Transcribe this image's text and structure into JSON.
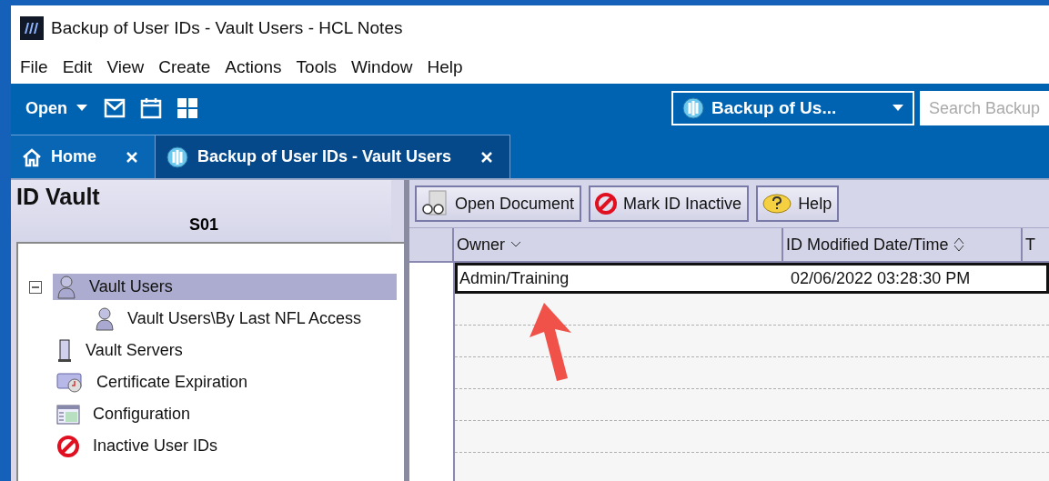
{
  "window": {
    "title": "Backup of User IDs - Vault Users - HCL Notes"
  },
  "menu": [
    "File",
    "Edit",
    "View",
    "Create",
    "Actions",
    "Tools",
    "Window",
    "Help"
  ],
  "toolbar": {
    "open_label": "Open",
    "database_picker": "Backup of Us...",
    "search": {
      "placeholder": "Search Backup"
    }
  },
  "tabs": [
    {
      "label": "Home",
      "kind": "home",
      "selected": false
    },
    {
      "label": "Backup of User IDs - Vault Users",
      "kind": "database",
      "selected": true
    }
  ],
  "navigator": {
    "title": "ID Vault",
    "server": "S01",
    "items": [
      {
        "label": "Vault Users",
        "kind": "user",
        "selected": true,
        "expanded": true,
        "children": [
          {
            "label": "Vault Users\\By Last NFL Access",
            "kind": "user",
            "selected": false
          }
        ]
      },
      {
        "label": "Vault Servers",
        "kind": "server",
        "selected": false
      },
      {
        "label": "Certificate Expiration",
        "kind": "certificate",
        "selected": false
      },
      {
        "label": "Configuration",
        "kind": "config",
        "selected": false
      },
      {
        "label": "Inactive User IDs",
        "kind": "inactive",
        "selected": false
      }
    ]
  },
  "actions": [
    {
      "label": "Open Document",
      "kind": "open"
    },
    {
      "label": "Mark ID Inactive",
      "kind": "inactive"
    },
    {
      "label": "Help",
      "kind": "help"
    }
  ],
  "table": {
    "columns": [
      {
        "label": "Owner",
        "kind": "sortdown"
      },
      {
        "label": "ID Modified Date/Time",
        "kind": "sortable"
      },
      {
        "label": "T",
        "kind": "plain"
      }
    ],
    "rows": [
      {
        "cells": [
          "Admin/Training",
          "02/06/2022 03:28:30 PM"
        ],
        "selected": true
      }
    ]
  }
}
